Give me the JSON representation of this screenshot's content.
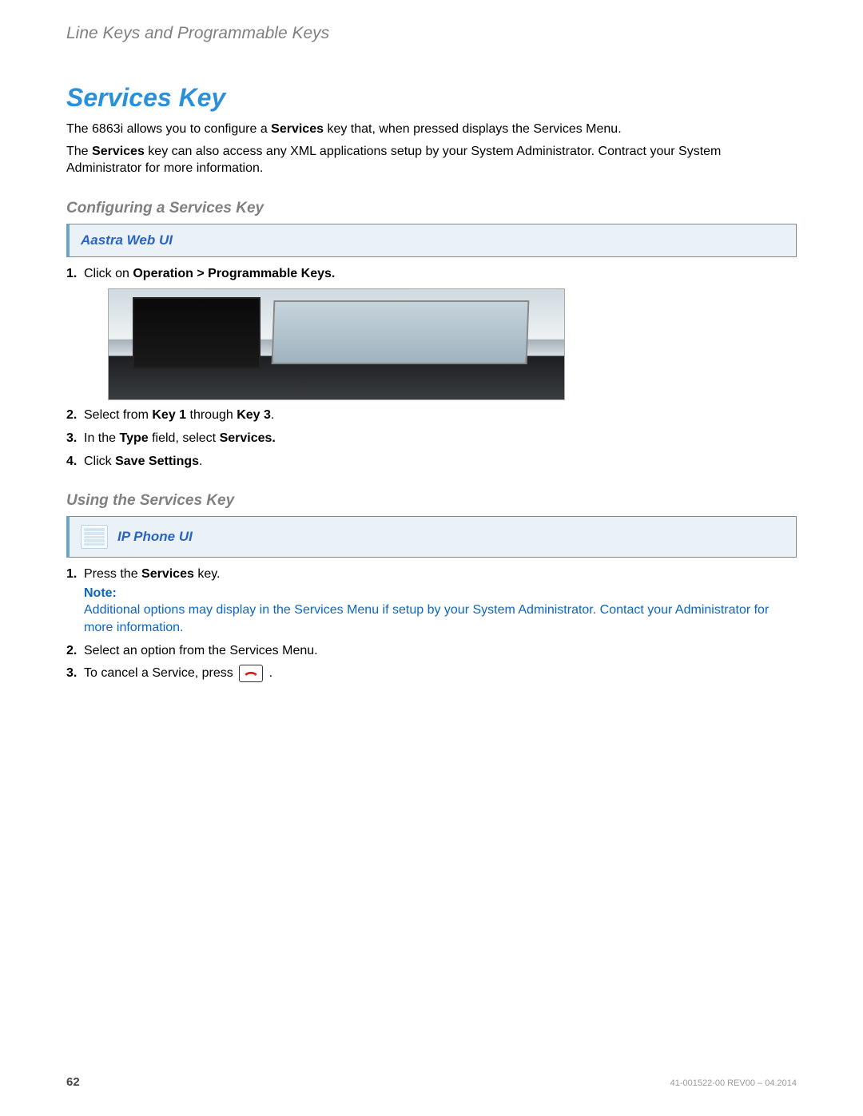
{
  "header": {
    "running": "Line Keys and Programmable Keys"
  },
  "section": {
    "title": "Services Key",
    "para1_a": "The 6863i allows you to configure a ",
    "para1_bold1": "Services",
    "para1_b": " key that, when pressed displays the Services Menu.",
    "para2_a": "The ",
    "para2_bold1": "Services",
    "para2_b": " key can also access any XML applications setup by your System Administrator. Contract your System Administrator for more information."
  },
  "configuring": {
    "title": "Configuring a Services Key",
    "banner": "Aastra Web UI",
    "steps": {
      "s1_a": "Click on ",
      "s1_bold": "Operation > Programmable Keys.",
      "s2_a": "Select from ",
      "s2_bold1": "Key 1",
      "s2_b": " through ",
      "s2_bold2": "Key 3",
      "s2_c": ".",
      "s3_a": "In the ",
      "s3_bold1": "Type",
      "s3_b": " field, select ",
      "s3_bold2": "Services.",
      "s4_a": "Click ",
      "s4_bold": "Save Settings",
      "s4_b": "."
    }
  },
  "using": {
    "title": "Using the Services Key",
    "banner": "IP Phone UI",
    "steps": {
      "s1_a": "Press the ",
      "s1_bold": "Services",
      "s1_b": " key.",
      "note_label": "Note:",
      "note_text": "Additional options may display in the Services Menu if setup by your System Administrator. Contact your Administrator for more information.",
      "s2": "Select an option from the Services Menu.",
      "s3_a": "To cancel a Service, press ",
      "s3_b": "."
    }
  },
  "footer": {
    "page": "62",
    "docid": "41-001522-00 REV00 – 04.2014"
  }
}
